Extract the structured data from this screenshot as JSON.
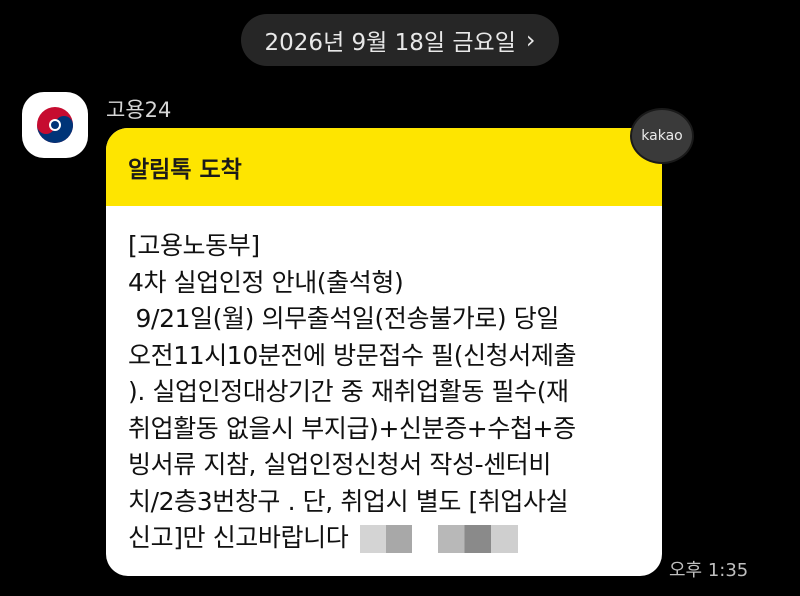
{
  "date_header": {
    "label": "2026년 9월 18일 금요일",
    "chevron": "›"
  },
  "sender": {
    "name": "고용24",
    "avatar_icon": "korea-government-emblem-icon"
  },
  "message": {
    "header": "알림톡 도착",
    "lines": [
      "[고용노동부]",
      "4차 실업인정 안내(출석형)",
      " 9/21일(월) 의무출석일(전송불가로) 당일",
      "오전11시10분전에 방문접수 필(신청서제출",
      "). 실업인정대상기간 중 재취업활동 필수(재",
      "취업활동 없을시 부지급)+신분증+수첩+증",
      "빙서류 지참, 실업인정신청서 작성-센터비",
      "치/2층3번창구 . 단, 취업시 별도 [취업사실",
      "신고]만 신고바랍니다"
    ],
    "badge": "kakao",
    "time": "오후 1:35"
  },
  "colors": {
    "background": "#000000",
    "header_yellow": "#fee500",
    "bubble": "#ffffff",
    "pill": "#262626"
  }
}
